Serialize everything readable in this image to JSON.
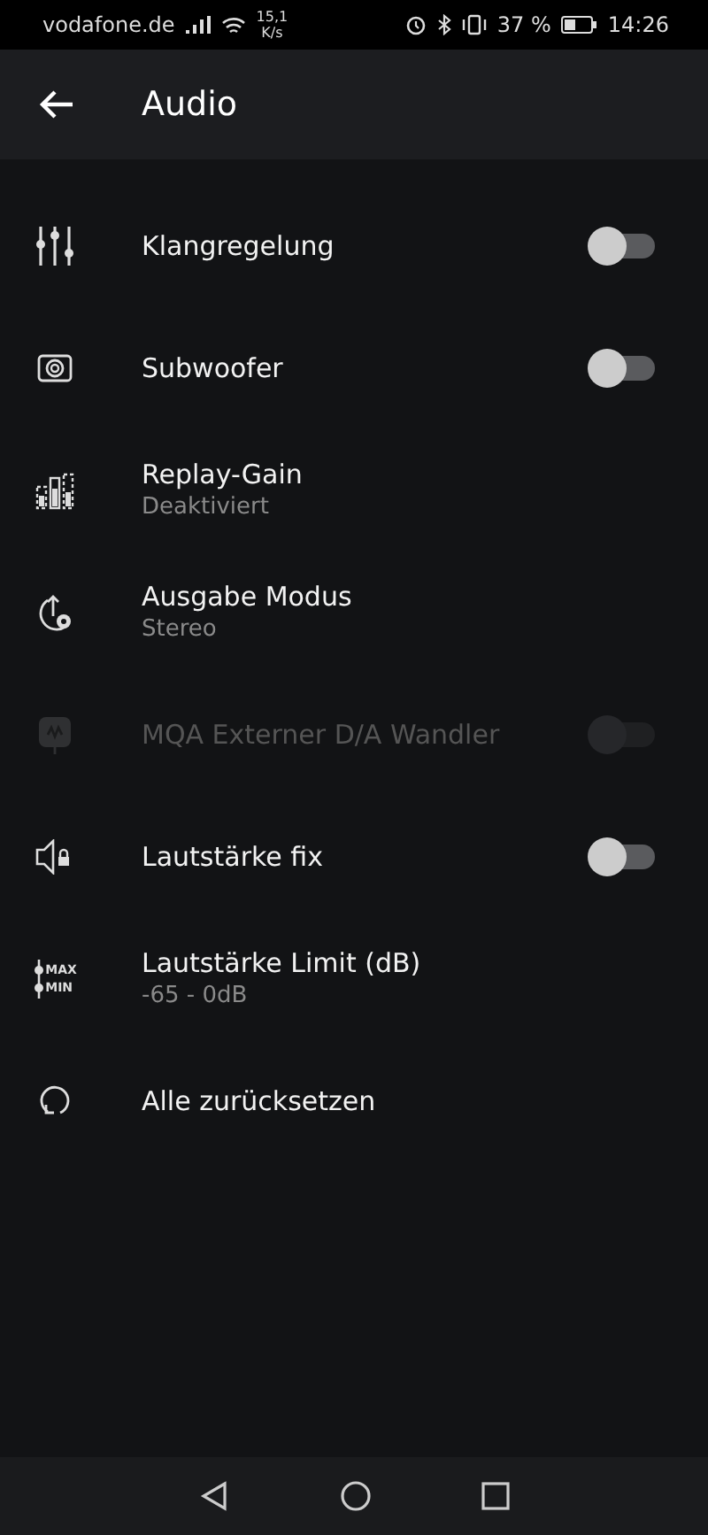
{
  "status_bar": {
    "carrier": "vodafone.de",
    "speed_value": "15,1",
    "speed_unit": "K/s",
    "battery": "37 %",
    "time": "14:26"
  },
  "header": {
    "title": "Audio"
  },
  "settings": [
    {
      "kind": "toggle",
      "title": "Klangregelung",
      "on": false,
      "disabled": false
    },
    {
      "kind": "toggle",
      "title": "Subwoofer",
      "on": false,
      "disabled": false
    },
    {
      "kind": "detail",
      "title": "Replay-Gain",
      "subtitle": "Deaktiviert"
    },
    {
      "kind": "detail",
      "title": "Ausgabe Modus",
      "subtitle": "Stereo"
    },
    {
      "kind": "toggle",
      "title": "MQA Externer D/A Wandler",
      "on": false,
      "disabled": true
    },
    {
      "kind": "toggle",
      "title": "Lautstärke fix",
      "on": false,
      "disabled": false
    },
    {
      "kind": "detail",
      "title": "Lautstärke Limit (dB)",
      "subtitle": "-65 - 0dB",
      "icon_labels": [
        "MAX",
        "MIN"
      ]
    },
    {
      "kind": "action",
      "title": "Alle zurücksetzen"
    }
  ]
}
